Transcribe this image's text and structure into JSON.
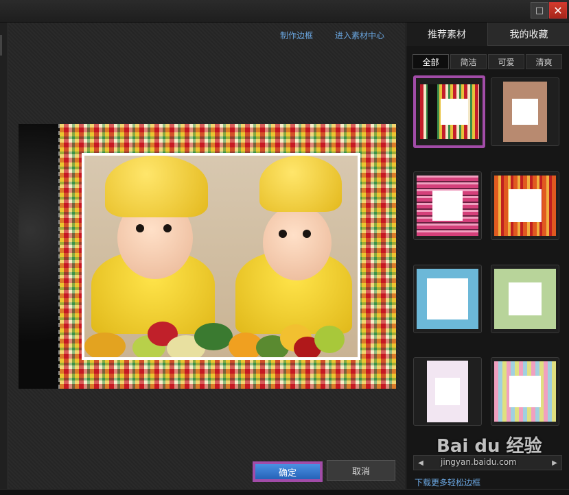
{
  "window": {
    "maximize_icon": "□",
    "close_icon": "✕"
  },
  "toolbar": {
    "make_frame_link": "制作边框",
    "material_center_link": "进入素材中心"
  },
  "tabs": [
    {
      "label": "推荐素材",
      "active": true
    },
    {
      "label": "我的收藏",
      "active": false
    }
  ],
  "filters": [
    {
      "label": "全部",
      "active": true
    },
    {
      "label": "简洁"
    },
    {
      "label": "可爱"
    },
    {
      "label": "清爽"
    }
  ],
  "thumbnails": [
    {
      "name": "plaid-black-frame",
      "selected": true
    },
    {
      "name": "brown-hearts-frame"
    },
    {
      "name": "pink-stripes-frame"
    },
    {
      "name": "orange-mosaic-frame"
    },
    {
      "name": "blue-dots-frame"
    },
    {
      "name": "green-dots-frame"
    },
    {
      "name": "pastel-plaid-frame"
    },
    {
      "name": "colorful-plaid-frame"
    }
  ],
  "pager": {
    "prev_icon": "◀",
    "next_icon": "▶"
  },
  "download_link": "下载更多轻松边框",
  "buttons": {
    "ok": "确定",
    "cancel": "取消"
  },
  "watermark": {
    "brand": "Bai du 经验",
    "url": "jingyan.baidu.com"
  },
  "colors": {
    "accent": "#a24ca8",
    "link": "#6aa6e0",
    "ok_button": "#3a7bd5"
  }
}
